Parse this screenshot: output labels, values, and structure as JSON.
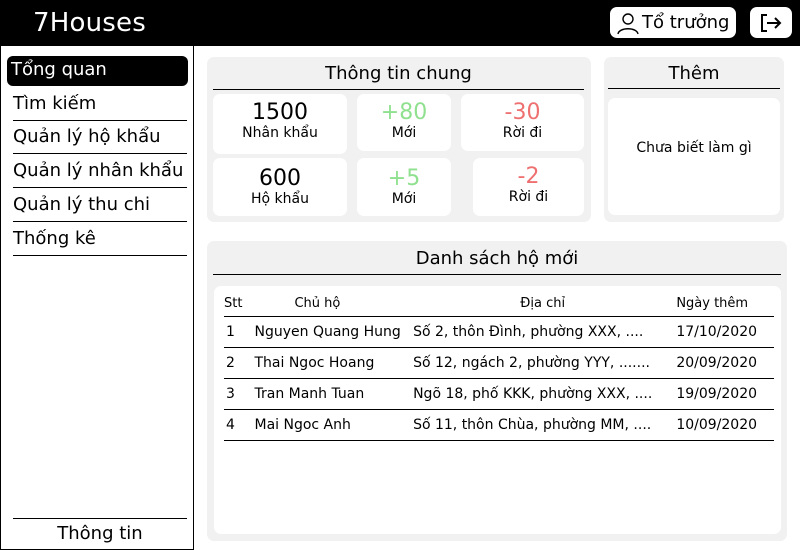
{
  "header": {
    "app_title": "7Houses",
    "user_label": "Tổ trưởng",
    "user_icon": "user-icon",
    "logout_icon": "logout-icon"
  },
  "sidebar": {
    "items": [
      {
        "label": "Tổng quan",
        "active": true
      },
      {
        "label": "Tìm kiếm"
      },
      {
        "label": "Quản lý hộ khẩu"
      },
      {
        "label": "Quản lý nhân khẩu"
      },
      {
        "label": "Quản lý thu chi"
      },
      {
        "label": "Thống kê"
      }
    ],
    "footer_label": "Thông tin"
  },
  "overview": {
    "title": "Thông tin chung",
    "population": {
      "value": "1500",
      "caption": "Nhân khẩu"
    },
    "population_new": {
      "value": "+80",
      "caption": "Mới"
    },
    "population_left": {
      "value": "-30",
      "caption": "Rời đi"
    },
    "households": {
      "value": "600",
      "caption": "Hộ khẩu"
    },
    "households_new": {
      "value": "+5",
      "caption": "Mới"
    },
    "households_left": {
      "value": "-2",
      "caption": "Rời đi"
    }
  },
  "more": {
    "title": "Thêm",
    "body": "Chưa biết làm gì"
  },
  "new_households": {
    "title": "Danh sách hộ mới",
    "columns": [
      "Stt",
      "Chủ hộ",
      "Địa chỉ",
      "Ngày thêm"
    ],
    "rows": [
      {
        "stt": "1",
        "owner": "Nguyen Quang Hung",
        "address": "Số 2, thôn Đình, phường XXX, ....",
        "date": "17/10/2020"
      },
      {
        "stt": "2",
        "owner": "Thai Ngoc Hoang",
        "address": "Số 12, ngách 2, phường YYY, .......",
        "date": "20/09/2020"
      },
      {
        "stt": "3",
        "owner": "Tran Manh Tuan",
        "address": "Ngõ 18, phố KKK, phường XXX, ....",
        "date": "19/09/2020"
      },
      {
        "stt": "4",
        "owner": "Mai Ngoc Anh",
        "address": "Số 11, thôn Chùa, phường MM, ....",
        "date": "10/09/2020"
      }
    ]
  },
  "colors": {
    "header_bg": "#000000",
    "panel_bg": "#f1f1f1",
    "positive": "#8fe08f",
    "negative": "#ee7070"
  }
}
